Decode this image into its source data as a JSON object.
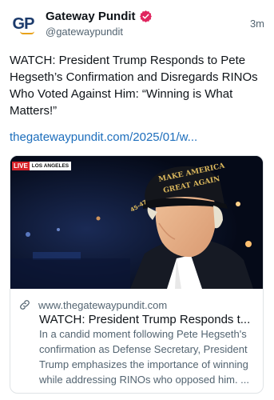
{
  "author": {
    "avatar_text": "GP",
    "display_name": "Gateway Pundit",
    "handle": "@gatewaypundit",
    "verified_icon": "verified-badge-icon",
    "timestamp": "3m"
  },
  "post": {
    "text": "WATCH: President Trump Responds to Pete Hegseth’s Confirmation and Disregards RINOs Who Voted Against Him: “Winning is What Matters!”",
    "link_text": "thegatewaypundit.com/2025/01/w..."
  },
  "card": {
    "image": {
      "live_label": "LIVE",
      "location_label": "LOS ANGELES",
      "cap_text_line1": "MAKE AMERICA",
      "cap_text_line2": "GREAT AGAIN",
      "cap_side_text": "45-47"
    },
    "domain": "www.thegatewaypundit.com",
    "title": "WATCH: President Trump Responds t...",
    "description": "In a candid moment following Pete Hegseth's confirmation as Defense Secretary, President Trump emphasizes the importance of winning while addressing RINOs who opposed him. ...",
    "link_icon": "link-icon"
  },
  "colors": {
    "link": "#1d6ebc",
    "secondary_text": "#536471",
    "verified": "#e0245e",
    "live_red": "#d8232a"
  }
}
